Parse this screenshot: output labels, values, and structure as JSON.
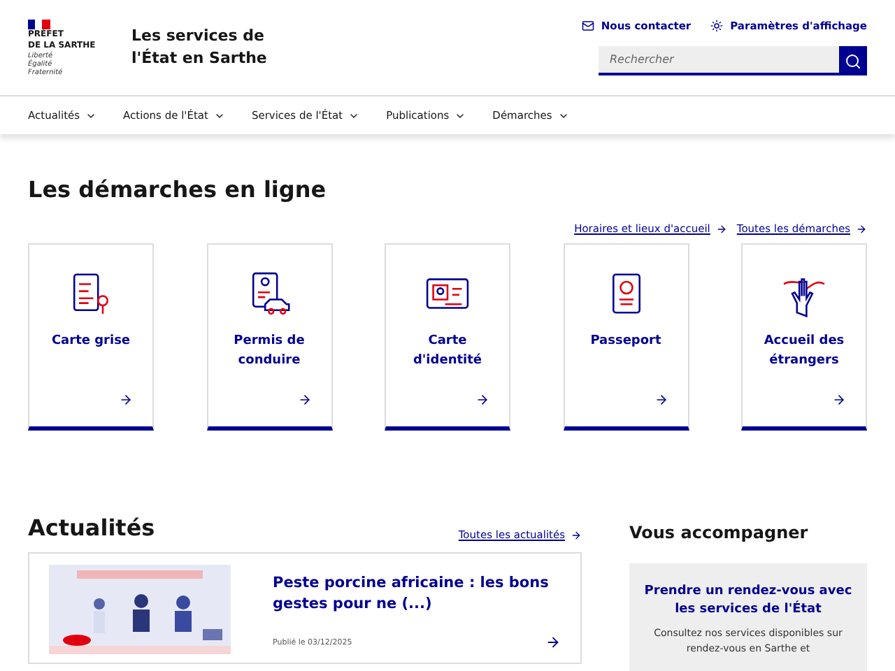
{
  "header": {
    "logo": {
      "lines": [
        "PRÉFET",
        "DE LA SARTHE"
      ],
      "motto": [
        "Liberté",
        "Égalité",
        "Fraternité"
      ]
    },
    "site_title": "Les services de l'État en Sarthe",
    "tools": [
      {
        "kind": "mail",
        "label": "Nous contacter"
      },
      {
        "kind": "display",
        "label": "Paramètres d'affichage"
      }
    ],
    "search": {
      "placeholder": "Rechercher"
    }
  },
  "nav": [
    "Actualités",
    "Actions de l'État",
    "Services de l'État",
    "Publications",
    "Démarches"
  ],
  "demarches": {
    "title": "Les démarches en ligne",
    "links": [
      "Horaires et lieux d'accueil",
      "Toutes les démarches"
    ],
    "cards": [
      {
        "kind": "registration",
        "label": "Carte grise"
      },
      {
        "kind": "license",
        "label": "Permis de conduire"
      },
      {
        "kind": "idcard",
        "label": "Carte d'identité"
      },
      {
        "kind": "passport",
        "label": "Passeport"
      },
      {
        "kind": "welcome",
        "label": "Accueil des étrangers"
      }
    ]
  },
  "news": {
    "title": "Actualités",
    "link": "Toutes les actualités",
    "items": [
      {
        "kind": "picture",
        "title": "Peste porcine africaine : les bons gestes pour ne (...)",
        "date": "Publié le 03/12/2025"
      }
    ]
  },
  "aside": {
    "title": "Vous accompagner",
    "card": {
      "title": "Prendre un rendez-vous avec les services de l'État",
      "text": "Consultez nos services disponibles sur rendez-vous en Sarthe et"
    }
  }
}
